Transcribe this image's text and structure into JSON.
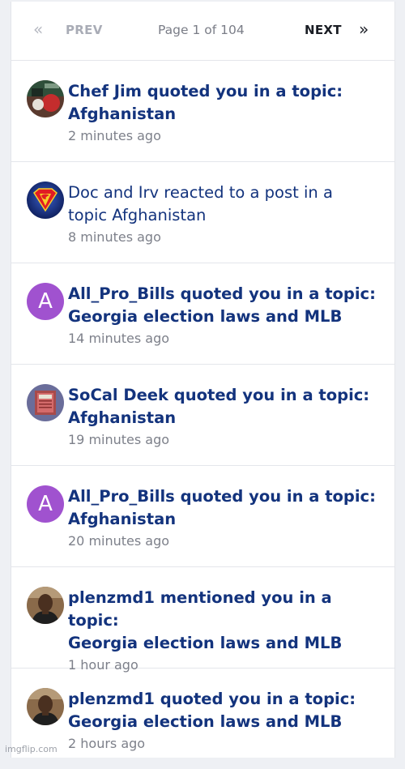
{
  "pager": {
    "first_icon": "double-chevron-left-icon",
    "prev_label": "PREV",
    "page_info": "Page 1 of 104",
    "next_label": "NEXT",
    "last_icon": "double-chevron-right-icon"
  },
  "notifications": [
    {
      "title_line1": "Chef Jim quoted you in a topic:",
      "title_line2": "Afghanistan",
      "time": "2 minutes ago",
      "avatar": "photo-chef"
    },
    {
      "title_line1": "Doc and Irv reacted to a post in a",
      "title_line2": "topic Afghanistan",
      "time": "8 minutes ago",
      "avatar": "superman-logo"
    },
    {
      "title_line1": "All_Pro_Bills quoted you in a topic:",
      "title_line2": "Georgia election laws and MLB",
      "time": "14 minutes ago",
      "avatar_letter": "A"
    },
    {
      "title_line1": "SoCal Deek quoted you in a topic:",
      "title_line2": "Afghanistan",
      "time": "19 minutes ago",
      "avatar": "photo-stadium"
    },
    {
      "title_line1": "All_Pro_Bills quoted you in a topic:",
      "title_line2": "Afghanistan",
      "time": "20 minutes ago",
      "avatar_letter": "A"
    },
    {
      "title_line1": "plenzmd1 mentioned you in a topic:",
      "title_line2": "Georgia election laws and MLB",
      "time": "1 hour ago",
      "avatar": "photo-person"
    },
    {
      "title_line1": "plenzmd1 quoted you in a topic:",
      "title_line2": "Georgia election laws and MLB",
      "time": "2 hours ago",
      "avatar": "photo-person"
    }
  ],
  "watermark": "imgflip.com",
  "colors": {
    "title": "#13337d",
    "time": "#7d808a",
    "letter_avatar": "#a052cf"
  }
}
